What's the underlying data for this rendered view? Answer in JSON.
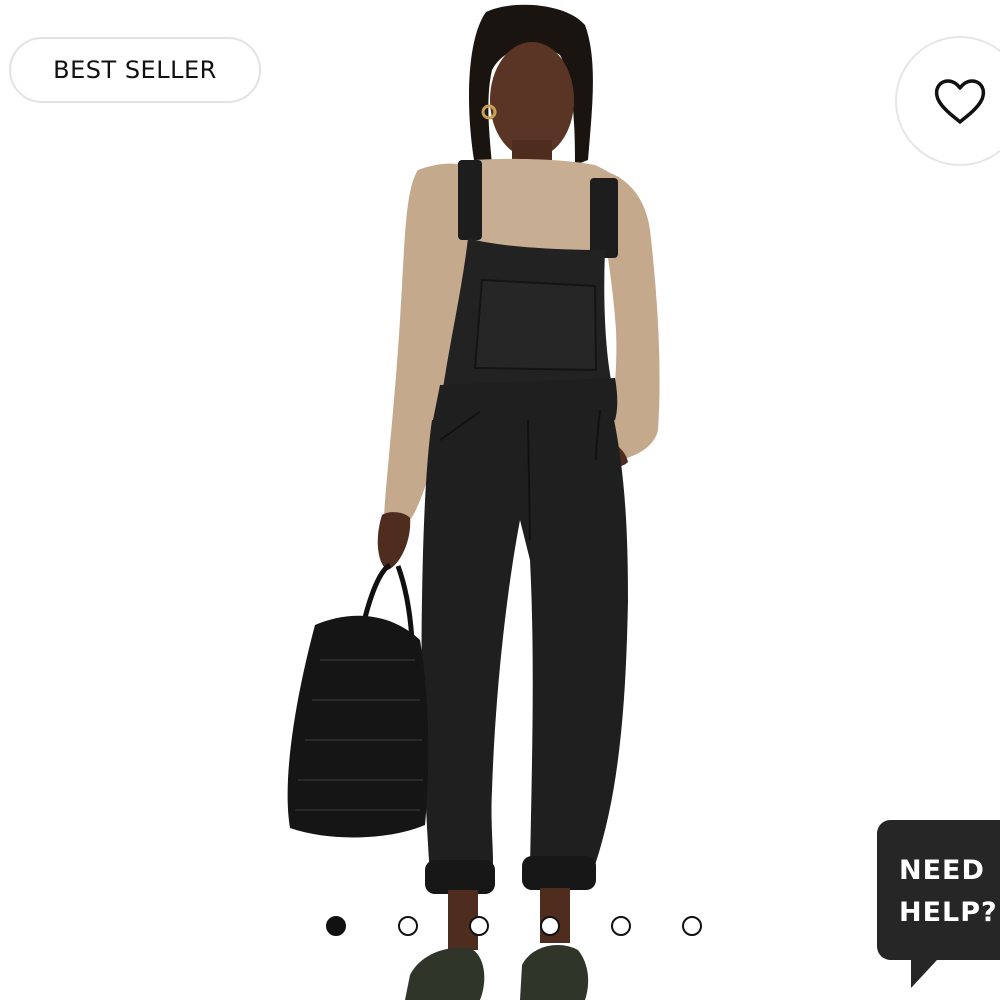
{
  "badge": {
    "label": "BEST SELLER"
  },
  "favorite": {
    "icon": "heart-icon"
  },
  "carousel": {
    "total": 6,
    "active_index": 0,
    "dots": [
      "slide-1",
      "slide-2",
      "slide-3",
      "slide-4",
      "slide-5",
      "slide-6"
    ]
  },
  "help": {
    "line1": "NEED",
    "line2": "HELP?",
    "icon": "chat-bubble-icon"
  },
  "colors": {
    "text": "#111111",
    "border": "#e3e3e3",
    "help_bg": "#262626",
    "top_color": "#c7ad92",
    "overalls_color": "#1f1f1f"
  }
}
